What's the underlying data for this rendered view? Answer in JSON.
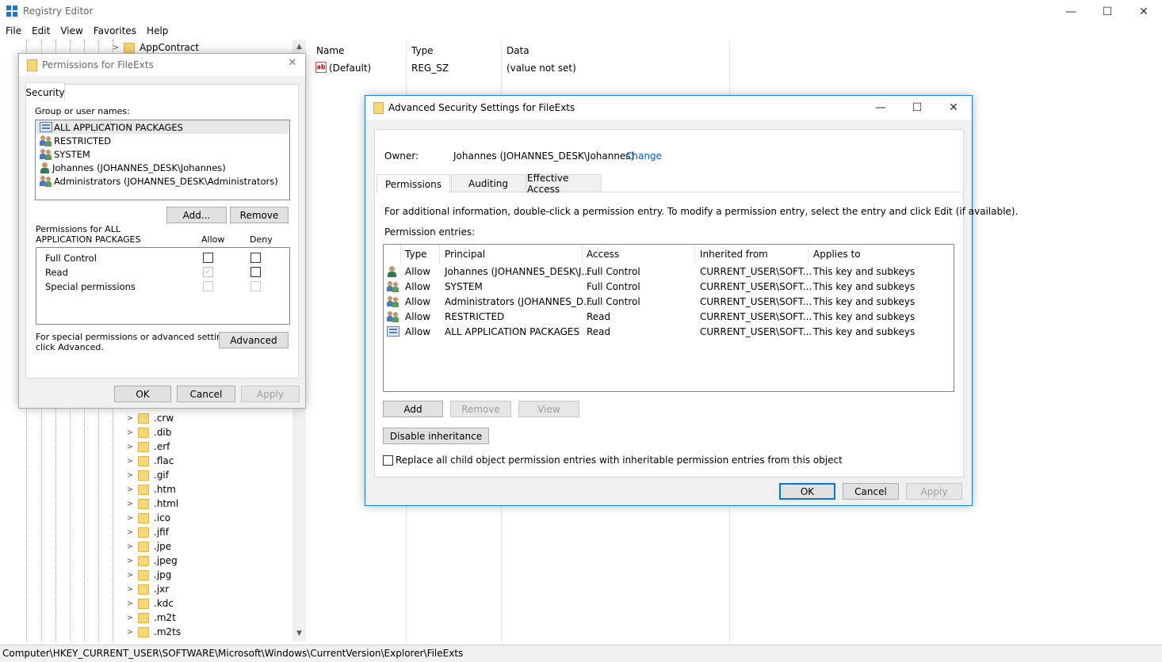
{
  "app": {
    "title": "Registry Editor",
    "minimize_glyph": "—",
    "maximize_glyph": "☐",
    "close_glyph": "✕"
  },
  "menu": [
    "File",
    "Edit",
    "View",
    "Favorites",
    "Help"
  ],
  "tree": {
    "top_item": "AppContract",
    "items": [
      ".crw",
      ".dib",
      ".erf",
      ".flac",
      ".gif",
      ".htm",
      ".html",
      ".ico",
      ".jfif",
      ".jpe",
      ".jpeg",
      ".jpg",
      ".jxr",
      ".kdc",
      ".m2t",
      ".m2ts"
    ]
  },
  "list": {
    "columns": [
      "Name",
      "Type",
      "Data"
    ],
    "rows": [
      {
        "icon": "string-value-icon",
        "name": "(Default)",
        "type": "REG_SZ",
        "data": "(value not set)"
      }
    ]
  },
  "status_path": "Computer\\HKEY_CURRENT_USER\\SOFTWARE\\Microsoft\\Windows\\CurrentVersion\\Explorer\\FileExts",
  "permissions_dialog": {
    "title": "Permissions for FileExts",
    "tab": "Security",
    "group_label": "Group or user names:",
    "principals": [
      {
        "icon": "package-icon",
        "name": "ALL APPLICATION PACKAGES"
      },
      {
        "icon": "group-icon",
        "name": "RESTRICTED"
      },
      {
        "icon": "group-icon",
        "name": "SYSTEM"
      },
      {
        "icon": "user-icon",
        "name": "Johannes (JOHANNES_DESK\\Johannes)"
      },
      {
        "icon": "group-icon",
        "name": "Administrators (JOHANNES_DESK\\Administrators)"
      }
    ],
    "add_button": "Add...",
    "remove_button": "Remove",
    "perms_for_label": "Permissions for ALL\nAPPLICATION PACKAGES",
    "allow_header": "Allow",
    "deny_header": "Deny",
    "permissions": [
      {
        "name": "Full Control",
        "allow": "unchecked",
        "deny": "unchecked"
      },
      {
        "name": "Read",
        "allow": "checked-disabled",
        "deny": "unchecked"
      },
      {
        "name": "Special permissions",
        "allow": "disabled",
        "deny": "disabled"
      }
    ],
    "advanced_hint": "For special permissions or advanced settings,\nclick Advanced.",
    "advanced_button": "Advanced",
    "ok": "OK",
    "cancel": "Cancel",
    "apply": "Apply"
  },
  "advanced_dialog": {
    "title": "Advanced Security Settings for FileExts",
    "owner_label": "Owner:",
    "owner_value": "Johannes (JOHANNES_DESK\\Johannes)",
    "change_link": "Change",
    "tabs": [
      "Permissions",
      "Auditing",
      "Effective Access"
    ],
    "info_text": "For additional information, double-click a permission entry. To modify a permission entry, select the entry and click Edit (if available).",
    "entries_label": "Permission entries:",
    "columns": [
      "Type",
      "Principal",
      "Access",
      "Inherited from",
      "Applies to"
    ],
    "entries": [
      {
        "icon": "user-icon",
        "type": "Allow",
        "principal": "Johannes (JOHANNES_DESK\\J...",
        "access": "Full Control",
        "inherited": "CURRENT_USER\\SOFT...",
        "applies": "This key and subkeys"
      },
      {
        "icon": "group-icon",
        "type": "Allow",
        "principal": "SYSTEM",
        "access": "Full Control",
        "inherited": "CURRENT_USER\\SOFT...",
        "applies": "This key and subkeys"
      },
      {
        "icon": "group-icon",
        "type": "Allow",
        "principal": "Administrators (JOHANNES_D...",
        "access": "Full Control",
        "inherited": "CURRENT_USER\\SOFT...",
        "applies": "This key and subkeys"
      },
      {
        "icon": "group-icon",
        "type": "Allow",
        "principal": "RESTRICTED",
        "access": "Read",
        "inherited": "CURRENT_USER\\SOFT...",
        "applies": "This key and subkeys"
      },
      {
        "icon": "package-icon",
        "type": "Allow",
        "principal": "ALL APPLICATION PACKAGES",
        "access": "Read",
        "inherited": "CURRENT_USER\\SOFT...",
        "applies": "This key and subkeys"
      }
    ],
    "add_button": "Add",
    "remove_button": "Remove",
    "view_button": "View",
    "disable_inheritance_button": "Disable inheritance",
    "replace_checkbox_label": "Replace all child object permission entries with inheritable permission entries from this object",
    "ok": "OK",
    "cancel": "Cancel",
    "apply": "Apply"
  }
}
